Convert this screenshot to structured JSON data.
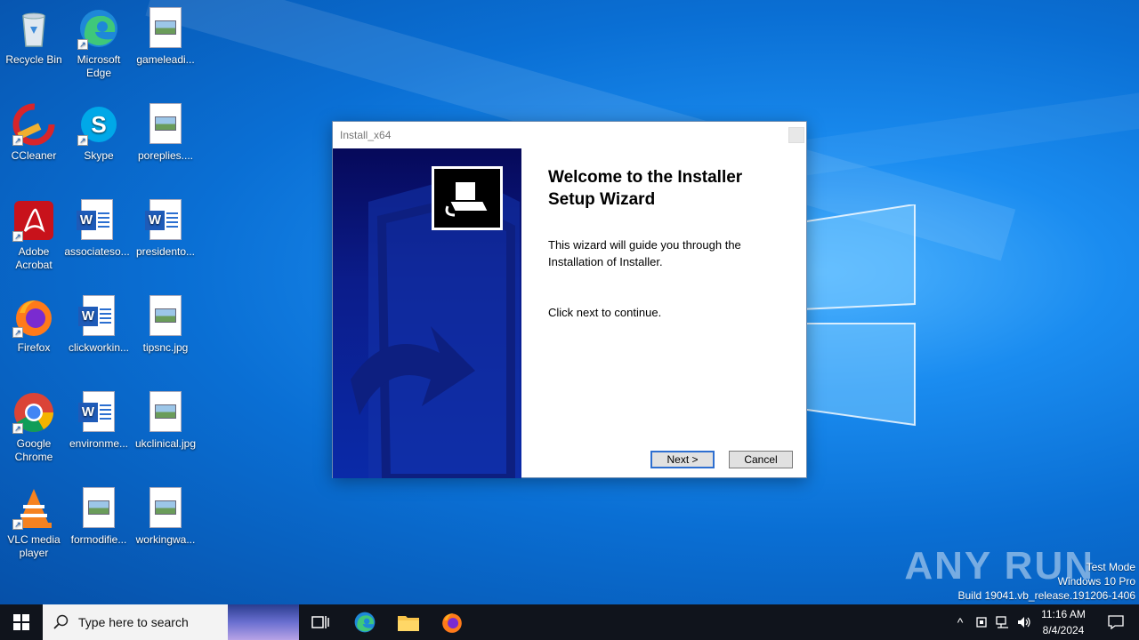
{
  "desktop": {
    "icons": [
      {
        "label": "Recycle Bin",
        "icon": "recycle-bin-icon"
      },
      {
        "label": "Microsoft Edge",
        "icon": "edge-icon"
      },
      {
        "label": "gameleadi...",
        "icon": "image-file-icon"
      },
      {
        "label": "CCleaner",
        "icon": "ccleaner-icon"
      },
      {
        "label": "Skype",
        "icon": "skype-icon"
      },
      {
        "label": "poreplies....",
        "icon": "image-file-icon"
      },
      {
        "label": "Adobe Acrobat",
        "icon": "acrobat-icon"
      },
      {
        "label": "associateso...",
        "icon": "word-doc-icon"
      },
      {
        "label": "presidento...",
        "icon": "word-doc-icon"
      },
      {
        "label": "Firefox",
        "icon": "firefox-icon"
      },
      {
        "label": "clickworkin...",
        "icon": "word-doc-icon"
      },
      {
        "label": "tipsnc.jpg",
        "icon": "image-file-icon"
      },
      {
        "label": "Google Chrome",
        "icon": "chrome-icon"
      },
      {
        "label": "environme...",
        "icon": "word-doc-icon"
      },
      {
        "label": "ukclinical.jpg",
        "icon": "image-file-icon"
      },
      {
        "label": "VLC media player",
        "icon": "vlc-icon"
      },
      {
        "label": "formodifie...",
        "icon": "image-file-icon"
      },
      {
        "label": "workingwa...",
        "icon": "image-file-icon"
      }
    ]
  },
  "dialog": {
    "title": "Install_x64",
    "heading": "Welcome to the Installer Setup Wizard",
    "intro": "This wizard will guide you through the Installation of Installer.",
    "instruction": "Click next to continue.",
    "next_label": "Next >",
    "cancel_label": "Cancel"
  },
  "watermark": {
    "text": "ANY RUN",
    "mode": "Test Mode",
    "edition": "Windows 10 Pro",
    "build": "Build 19041.vb_release.191206-1406"
  },
  "taskbar": {
    "search_placeholder": "Type here to search",
    "time": "11:16 AM",
    "date": "8/4/2024"
  },
  "colors": {
    "desktop_bg": "#0a78d8",
    "taskbar_bg": "#10141c",
    "banner_bg": "#0b1c8a"
  }
}
